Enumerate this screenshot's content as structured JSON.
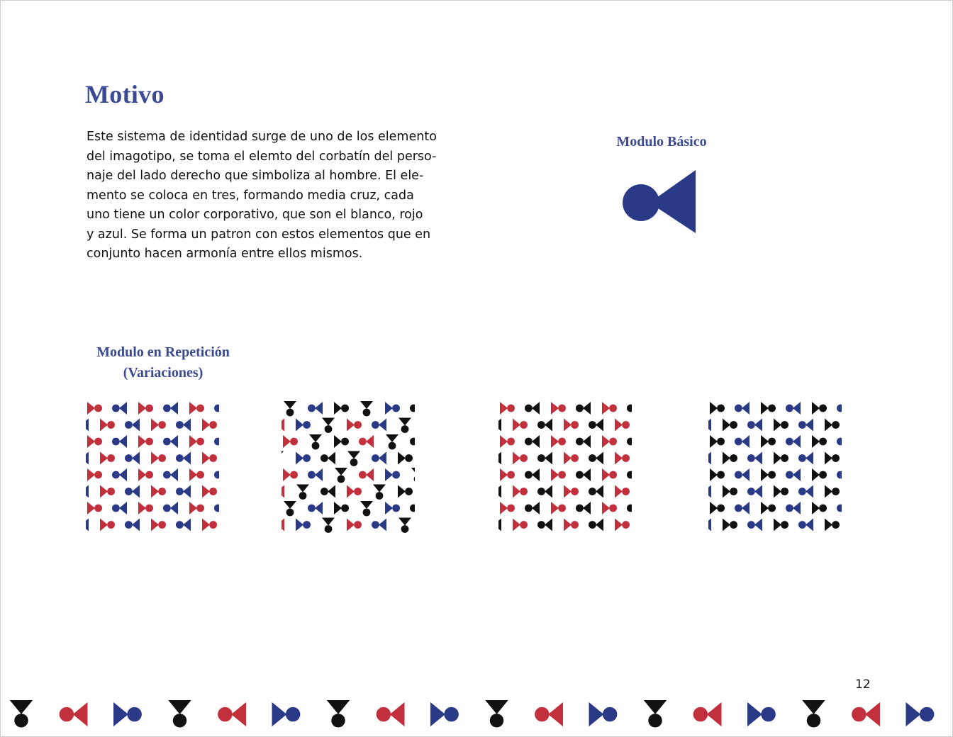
{
  "page": {
    "title": "Motivo",
    "paragraph_lines": [
      "Este sistema de identidad surge de uno de los elemento",
      "del imagotipo, se toma el elemto del corbatín del perso-",
      "naje del lado derecho que simboliza al hombre. El ele-",
      "mento se coloca en tres, formando media cruz, cada",
      "uno tiene un color corporativo, que son el blanco, rojo",
      "y azul. Se forma un patron con estos elementos que en",
      "conjunto hacen armonía entre ellos mismos."
    ],
    "basic_module_label": "Modulo Básico",
    "repetition_label_line1": "Modulo en Repetición",
    "repetition_label_line2": "(Variaciones)",
    "page_number": "12"
  },
  "colors": {
    "title": "#3b4a94",
    "blue": "#2b3a87",
    "red": "#c1303c",
    "black": "#111111",
    "white": "#ffffff"
  },
  "icons": {
    "basic_module": "bowtie-motif-icon"
  },
  "patterns": [
    {
      "name": "pattern-red-blue",
      "colors": [
        "red",
        "blue"
      ]
    },
    {
      "name": "pattern-red-blue-black",
      "colors": [
        "red",
        "blue",
        "black"
      ]
    },
    {
      "name": "pattern-red-black",
      "colors": [
        "red",
        "black"
      ]
    },
    {
      "name": "pattern-blue-black",
      "colors": [
        "black",
        "blue"
      ]
    }
  ]
}
